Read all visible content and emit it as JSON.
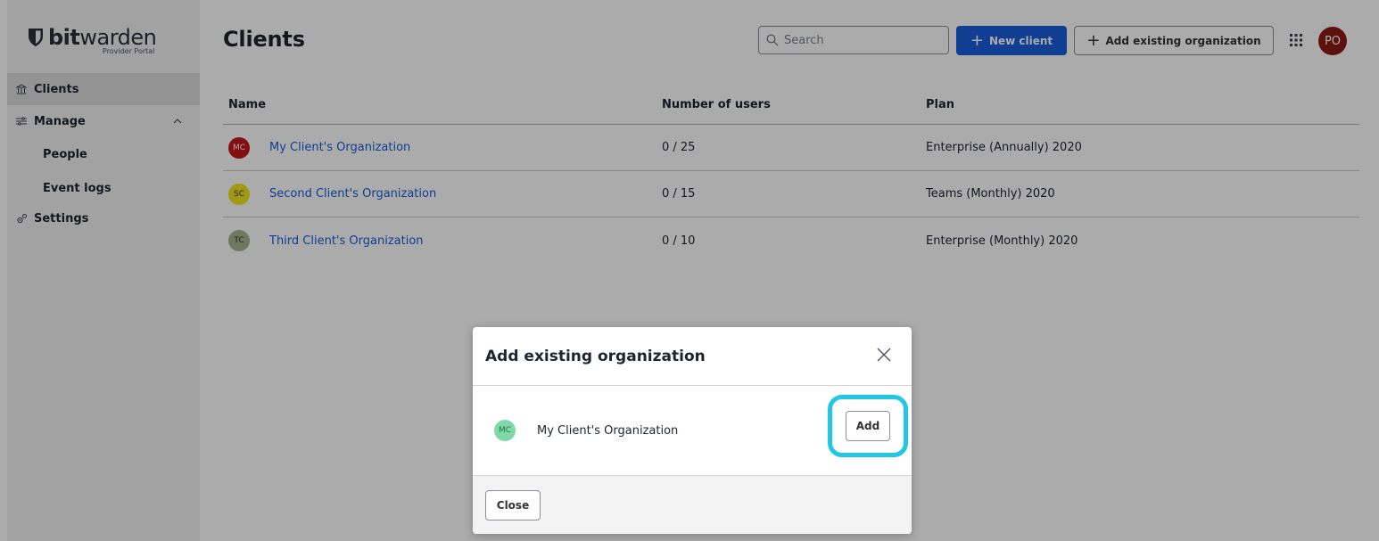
{
  "brand": {
    "name_bold": "bit",
    "name_light": "warden",
    "subtitle": "Provider Portal"
  },
  "sidebar": {
    "items": [
      {
        "label": "Clients",
        "icon": "bank-icon"
      },
      {
        "label": "Manage",
        "icon": "sliders-icon"
      },
      {
        "label": "People"
      },
      {
        "label": "Event logs"
      },
      {
        "label": "Settings",
        "icon": "gears-icon"
      }
    ]
  },
  "header": {
    "title": "Clients",
    "search_placeholder": "Search",
    "new_client_label": "New client",
    "add_existing_label": "Add existing organization",
    "user_initials": "PO"
  },
  "table": {
    "columns": [
      "Name",
      "Number of users",
      "Plan"
    ],
    "rows": [
      {
        "initials": "MC",
        "name": "My Client's Organization",
        "users": "0 / 25",
        "plan": "Enterprise (Annually) 2020",
        "avatar_color": "#c4161c",
        "avatar_text_color": "#ffffff"
      },
      {
        "initials": "SC",
        "name": "Second Client's Organization",
        "users": "0 / 15",
        "plan": "Teams (Monthly) 2020",
        "avatar_color": "#f1e41e",
        "avatar_text_color": "#333333"
      },
      {
        "initials": "TC",
        "name": "Third Client's Organization",
        "users": "0 / 10",
        "plan": "Enterprise (Monthly) 2020",
        "avatar_color": "#a7b48d",
        "avatar_text_color": "#333333"
      }
    ]
  },
  "modal": {
    "title": "Add existing organization",
    "org_initials": "MC",
    "org_name": "My Client's Organization",
    "add_label": "Add",
    "close_label": "Close",
    "org_avatar_color": "#7dd9a7"
  },
  "colors": {
    "primary": "#175ddc",
    "highlight_ring": "#22c7e3"
  }
}
